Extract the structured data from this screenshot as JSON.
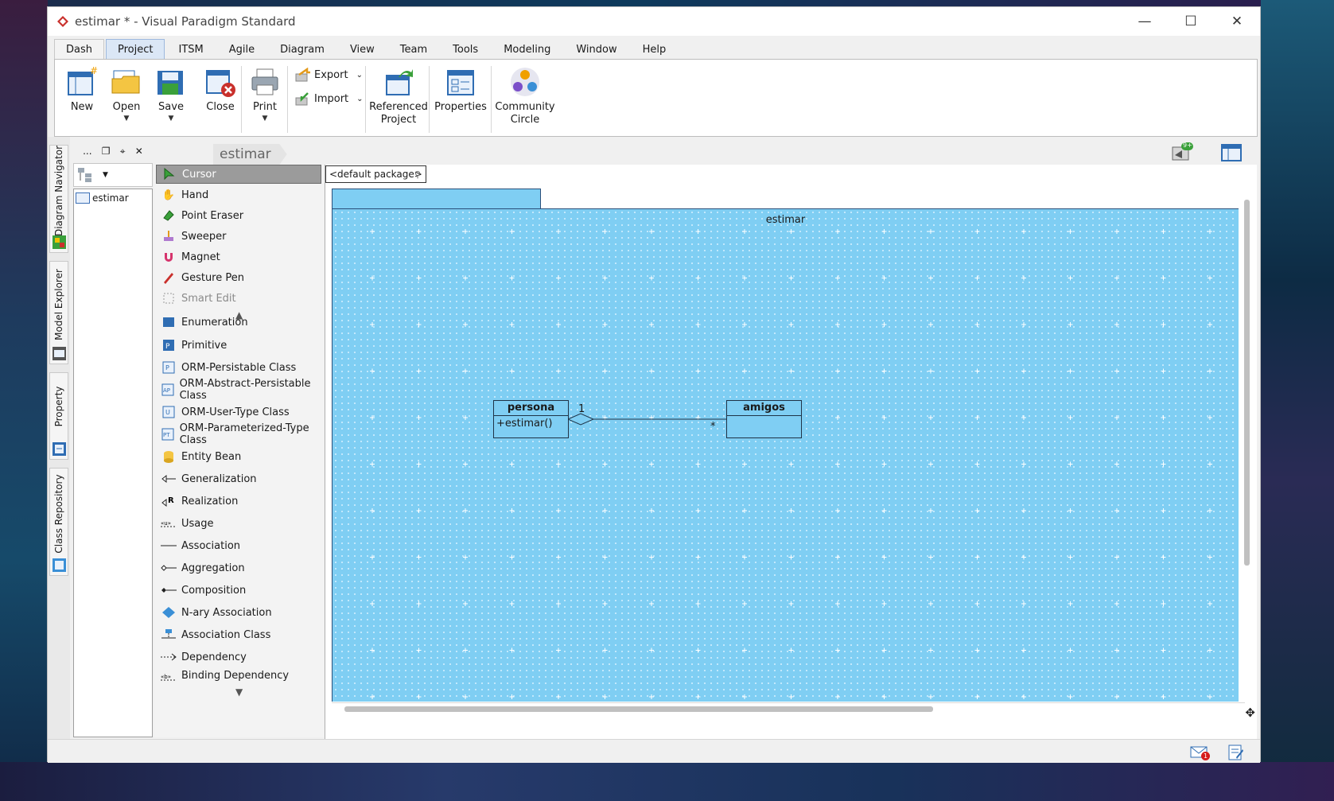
{
  "window": {
    "title": "estimar * - Visual Paradigm Standard",
    "controls": {
      "minimize": "—",
      "maximize": "☐",
      "close": "✕"
    }
  },
  "menu": {
    "tabs": [
      "Dash",
      "Project",
      "ITSM",
      "Agile",
      "Diagram",
      "View",
      "Team",
      "Tools",
      "Modeling",
      "Window",
      "Help"
    ],
    "active": "Project"
  },
  "ribbon": {
    "new": "New",
    "open": "Open",
    "save": "Save",
    "close": "Close",
    "print": "Print",
    "export": "Export",
    "import": "Import",
    "referenced_project": [
      "Referenced",
      "Project"
    ],
    "properties": "Properties",
    "community_circle": [
      "Community",
      "Circle"
    ]
  },
  "side_tabs": [
    "Diagram Navigator",
    "Model Explorer",
    "Property",
    "Class Repository"
  ],
  "navigator": {
    "toolbar": [
      "...",
      "❐",
      "⌖",
      "✕"
    ],
    "tree_item": "estimar"
  },
  "breadcrumb": "estimar",
  "palette": {
    "top_items": [
      "Cursor",
      "Hand",
      "Point Eraser",
      "Sweeper",
      "Magnet",
      "Gesture Pen",
      "Smart Edit"
    ],
    "selected": "Cursor",
    "items": [
      "Enumeration",
      "Primitive",
      "ORM-Persistable Class",
      "ORM-Abstract-Persistable Class",
      "ORM-User-Type Class",
      "ORM-Parameterized-Type Class",
      "Entity Bean",
      "Generalization",
      "Realization",
      "Usage",
      "Association",
      "Aggregation",
      "Composition",
      "N-ary Association",
      "Association Class",
      "Dependency",
      "Binding Dependency"
    ]
  },
  "canvas": {
    "package": "<default package>",
    "frame_title": "estimar",
    "classes": [
      {
        "name": "persona",
        "operations": [
          "+estimar()"
        ]
      },
      {
        "name": "amigos",
        "operations": []
      }
    ],
    "association": {
      "source_multiplicity": "1",
      "target_multiplicity": "*",
      "type": "aggregation"
    }
  },
  "status": {
    "notification_count": "9+",
    "mail_badge": "1"
  },
  "colors": {
    "canvas_fill": "#7fcef3",
    "selected_tool": "#9b9b9b",
    "active_tab": "#dbe7f6"
  }
}
